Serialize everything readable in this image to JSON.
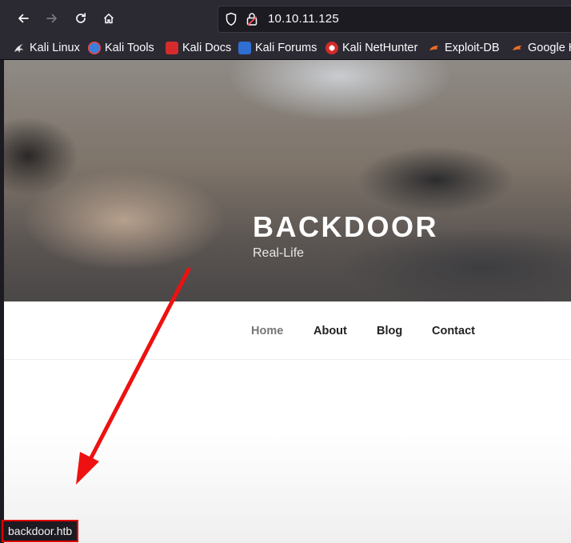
{
  "browser": {
    "url": "10.10.11.125",
    "bookmarks": [
      {
        "label": "Kali Linux",
        "icon": "kali-dragon-icon"
      },
      {
        "label": "Kali Tools",
        "icon": "kali-tools-icon"
      },
      {
        "label": "Kali Docs",
        "icon": "kali-docs-icon"
      },
      {
        "label": "Kali Forums",
        "icon": "kali-forums-icon"
      },
      {
        "label": "Kali NetHunter",
        "icon": "kali-nethunter-icon"
      },
      {
        "label": "Exploit-DB",
        "icon": "exploit-db-icon"
      },
      {
        "label": "Google H",
        "icon": "google-hacking-icon"
      }
    ]
  },
  "site": {
    "title": "BACKDOOR",
    "tagline": "Real-Life",
    "nav": [
      "Home",
      "About",
      "Blog",
      "Contact"
    ]
  },
  "status_bar": {
    "text": "backdoor.htb"
  },
  "colors": {
    "annotation": "#e00000",
    "toolbar": "#2b2a33"
  }
}
